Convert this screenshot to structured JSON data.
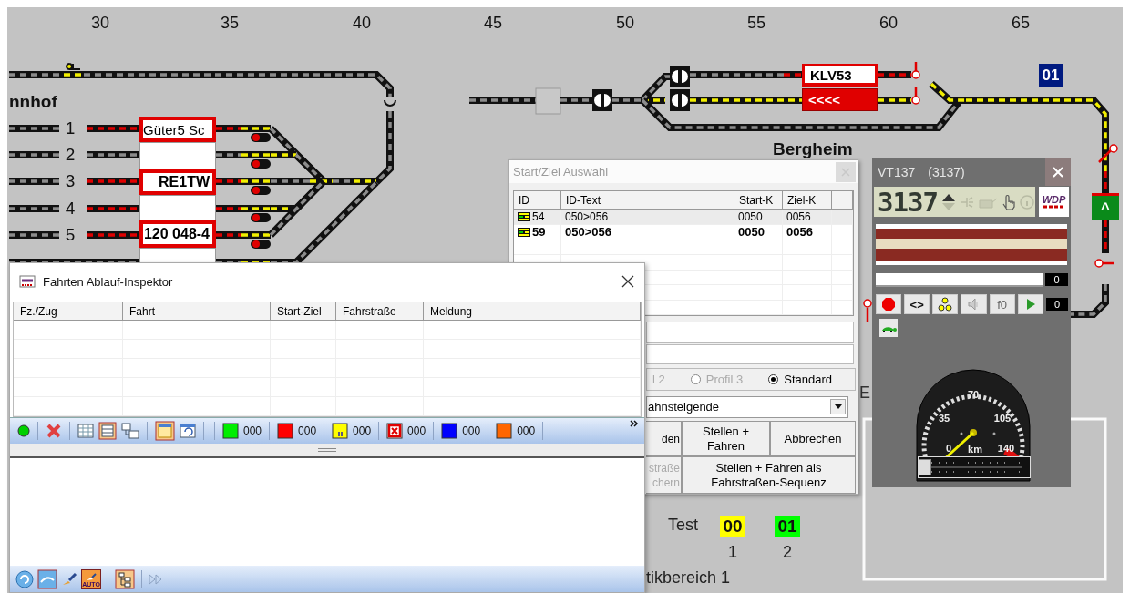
{
  "ruler": [
    "30",
    "35",
    "40",
    "45",
    "50",
    "55",
    "60",
    "65"
  ],
  "station_labels": [
    "nnhof",
    "Bergheim"
  ],
  "track_numbers": [
    "1",
    "2",
    "3",
    "4",
    "5"
  ],
  "platform_boxes": [
    {
      "text": "Güter5 Sc",
      "occupied": true,
      "bold": false
    },
    {
      "occupied": false
    },
    {
      "text": "RE1TW",
      "occupied": true,
      "bold": true
    },
    {
      "occupied": false
    },
    {
      "text": "120 048-4",
      "occupied": true,
      "bold": true
    },
    {
      "occupied": false
    }
  ],
  "block_boxes": [
    {
      "kind": "train",
      "text": "KLV53"
    },
    {
      "kind": "direction",
      "text": "<<<<"
    }
  ],
  "block_number": "01",
  "exit_signal": "^",
  "counters": {
    "label": "Test",
    "items": [
      {
        "value": "00",
        "index": "1",
        "color": "#ffff00"
      },
      {
        "value": "01",
        "index": "2",
        "color": "#00ff00"
      }
    ]
  },
  "area_label": "tikbereich 1",
  "side_label": "E",
  "start_ziel_window": {
    "title": "Start/Ziel Auswahl",
    "columns": [
      "ID",
      "ID-Text",
      "Start-K",
      "Ziel-K"
    ],
    "rows": [
      {
        "id": "54",
        "text": "050>056",
        "start": "0050",
        "ziel": "0056",
        "selected": true,
        "bold": false
      },
      {
        "id": "59",
        "text": "050>056",
        "start": "0050",
        "ziel": "0056",
        "selected": false,
        "bold": true
      }
    ],
    "radios": [
      {
        "kind": "clipped",
        "label": "l 2",
        "selected": false,
        "disabled": true
      },
      {
        "kind": "radio",
        "label": "Profil 3",
        "selected": false,
        "disabled": true
      },
      {
        "kind": "radio",
        "label": "Standard",
        "selected": true,
        "disabled": false
      }
    ],
    "dropdown": "ahnsteigende",
    "buttons": [
      {
        "label": "den",
        "disabled": false
      },
      {
        "label": "Stellen +\nFahren",
        "disabled": false
      },
      {
        "label": "Abbrechen",
        "disabled": false
      },
      {
        "label": "straße\nchern",
        "disabled": true
      },
      {
        "label": "Stellen + Fahren als\nFahrstraßen-Sequenz",
        "disabled": false
      }
    ]
  },
  "inspector_window": {
    "title": "Fahrten Ablauf-Inspektor",
    "columns": [
      "Fz./Zug",
      "Fahrt",
      "Start-Ziel",
      "Fahrstraße",
      "Meldung"
    ],
    "counters": [
      {
        "kind": "plain",
        "color": "#00ee00",
        "count": "000"
      },
      {
        "kind": "plain",
        "color": "#ff0000",
        "count": "000"
      },
      {
        "kind": "pause",
        "color": "#ffff00",
        "count": "000"
      },
      {
        "kind": "cross",
        "color": "#e00000",
        "count": "000"
      },
      {
        "kind": "plain",
        "color": "#0000ff",
        "count": "000"
      },
      {
        "kind": "plain",
        "color": "#ff6600",
        "count": "000"
      }
    ],
    "auto_label": "AUTO"
  },
  "loco_window": {
    "name": "VT137",
    "address": "(3137)",
    "display": "3137",
    "logo": "WDP",
    "speed_reading": "0",
    "step_reading": "0",
    "buttons": [
      {
        "kind": "stop"
      },
      {
        "kind": "text",
        "label": "<>"
      },
      {
        "kind": "dots"
      },
      {
        "kind": "sound"
      },
      {
        "kind": "text",
        "label": "f0"
      },
      {
        "kind": "play"
      }
    ],
    "gauge_labels": [
      "70",
      "35",
      "105",
      "0",
      "km",
      "140"
    ],
    "speed_slider": {
      "level": 0
    }
  }
}
